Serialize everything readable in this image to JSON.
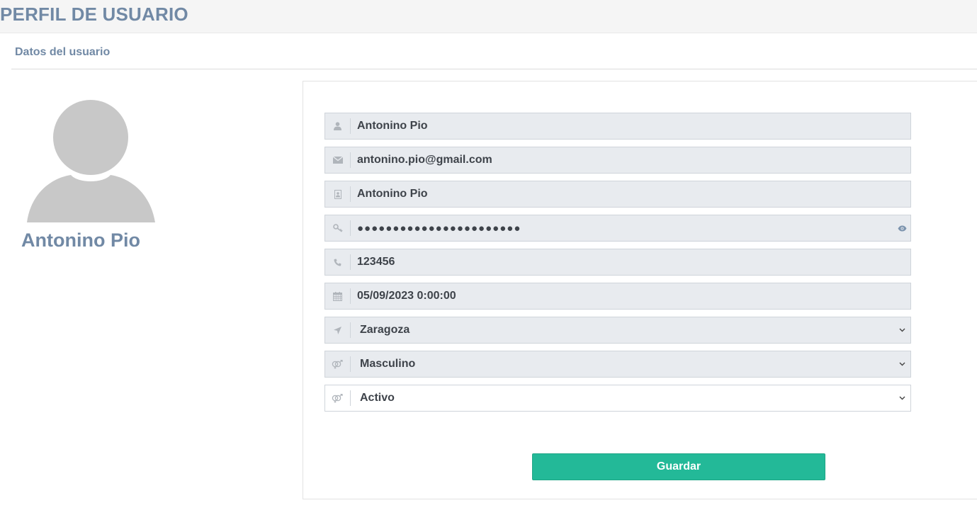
{
  "header": {
    "title": "PERFIL DE USUARIO"
  },
  "section": {
    "title": "Datos del usuario"
  },
  "profile": {
    "name": "Antonino Pio"
  },
  "fields": {
    "username": {
      "icon": "user-icon",
      "value": "Antonino Pio"
    },
    "email": {
      "icon": "envelope-icon",
      "value": "antonino.pio@gmail.com"
    },
    "fullname": {
      "icon": "id-card-icon",
      "value": "Antonino Pio"
    },
    "password": {
      "icon": "key-icon",
      "value": "●●●●●●●●●●●●●●●●●●●●●●●",
      "toggle_icon": "eye-icon"
    },
    "phone": {
      "icon": "phone-icon",
      "value": "123456"
    },
    "date": {
      "icon": "calendar-icon",
      "value": "05/09/2023 0:00:00"
    },
    "city": {
      "icon": "location-arrow-icon",
      "selected": "Zaragoza"
    },
    "gender": {
      "icon": "gender-icon",
      "selected": "Masculino"
    },
    "status": {
      "icon": "gender-icon",
      "selected": "Activo"
    }
  },
  "actions": {
    "save_label": "Guardar"
  },
  "colors": {
    "accent": "#7189a5",
    "button": "#23b998",
    "field_bg": "#e8ebef"
  }
}
